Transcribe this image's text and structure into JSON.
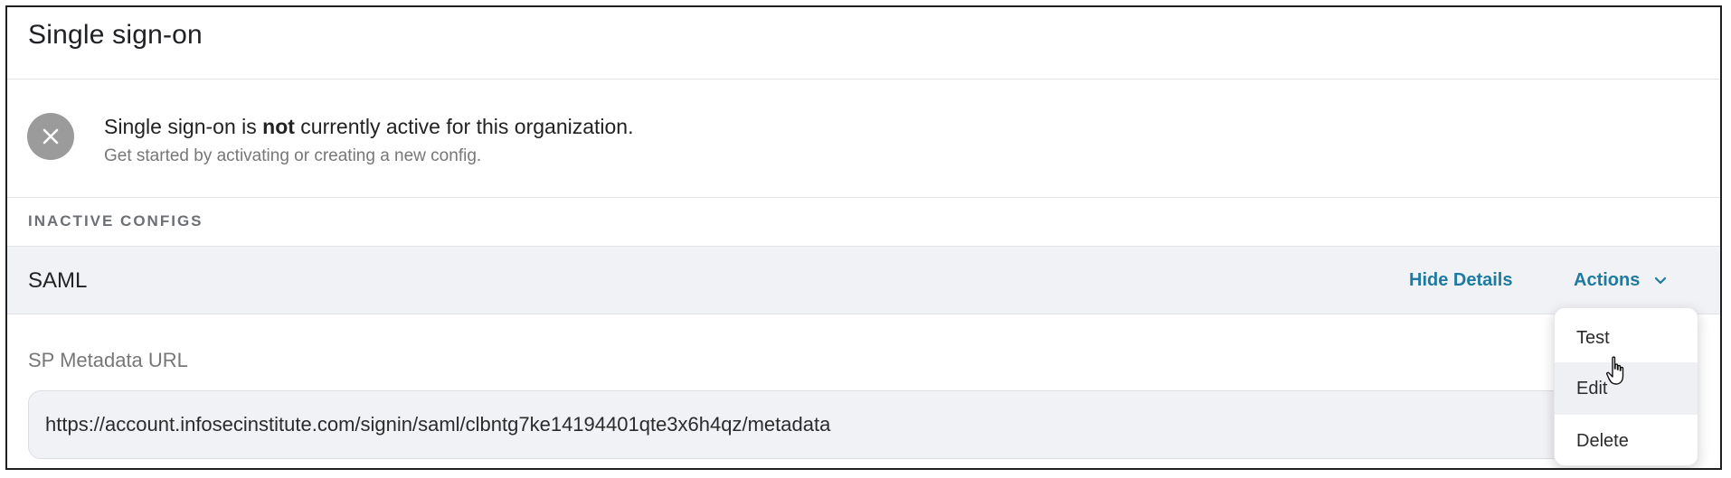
{
  "header": {
    "title": "Single sign-on"
  },
  "status": {
    "message_prefix": "Single sign-on is ",
    "message_emphasis": "not",
    "message_suffix": " currently active for this organization.",
    "subtext": "Get started by activating or creating a new config.",
    "icon": "close-icon"
  },
  "section": {
    "label": "INACTIVE CONFIGS"
  },
  "config": {
    "name": "SAML",
    "hide_details_label": "Hide Details",
    "actions_label": "Actions"
  },
  "details": {
    "field_label": "SP Metadata URL",
    "field_value": "https://account.infosecinstitute.com/signin/saml/clbntg7ke14194401qte3x6h4qz/metadata"
  },
  "actions_menu": {
    "items": [
      "Test",
      "Edit",
      "Delete"
    ],
    "hovered": "Edit"
  },
  "colors": {
    "accent": "#1f7aa0",
    "status_icon": "#9b9b9b",
    "row_bg": "#f1f2f5"
  }
}
